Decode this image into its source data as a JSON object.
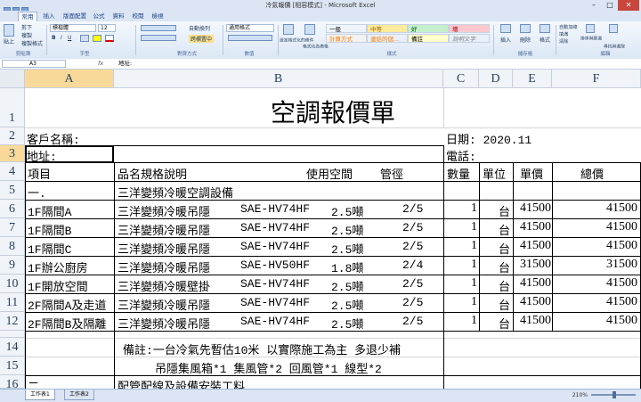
{
  "window": {
    "title": "冷氣報價 [相容模式] - Microsoft Excel",
    "buttons": [
      "–",
      "□",
      "✕"
    ]
  },
  "tabs": [
    {
      "label": "常用",
      "active": true
    },
    {
      "label": "插入"
    },
    {
      "label": "版面配置"
    },
    {
      "label": "公式"
    },
    {
      "label": "資料"
    },
    {
      "label": "校閱"
    },
    {
      "label": "檢視"
    }
  ],
  "ribbon": {
    "paste_label": "貼上",
    "cut_label": "剪下",
    "copy_label": "複製",
    "format_painter_label": "複製格式",
    "font_name": "標楷體",
    "font_size": "12",
    "wrap_text_label": "自動換列",
    "merge_center_label": "跨欄置中",
    "number_format": "通用格式",
    "cond_format_label": "設定格式化的條件",
    "format_table_label": "格式化為表格",
    "styles": [
      {
        "label": "一般",
        "color": "#ffffff",
        "text": "#000000"
      },
      {
        "label": "中等",
        "color": "#ffeb9c",
        "text": "#9c6500"
      },
      {
        "label": "好",
        "color": "#c6efce",
        "text": "#006100"
      },
      {
        "label": "壞",
        "color": "#ffc7ce",
        "text": "#9c0006"
      },
      {
        "label": "計算方式",
        "color": "#f2f2f2",
        "text": "#fa7d00"
      },
      {
        "label": "連結的儲...",
        "color": "#ffffff",
        "text": "#fa7d00"
      },
      {
        "label": "備註",
        "color": "#ffffcc",
        "text": "#000000"
      },
      {
        "label": "說明文字",
        "color": "#ffffff",
        "text": "#7f7f7f"
      }
    ],
    "insert_label": "插入",
    "delete_label": "刪除",
    "format_label": "格式",
    "autosum_label": "自動加總",
    "fill_label": "填滿",
    "clear_label": "清除",
    "sort_filter_label": "排序與篩選",
    "find_select_label": "尋找與選取",
    "groups": [
      "剪貼簿",
      "字型",
      "對齊方式",
      "數值",
      "樣式",
      "儲存格",
      "編輯"
    ]
  },
  "formula_bar": {
    "name_box": "A3",
    "fx": "fx",
    "content": "地址:"
  },
  "columns": [
    "A",
    "B",
    "C",
    "D",
    "E",
    "F"
  ],
  "rows": [
    "1",
    "2",
    "3",
    "4",
    "5",
    "6",
    "7",
    "8",
    "9",
    "10",
    "11",
    "12",
    "13",
    "14",
    "15",
    "16"
  ],
  "sheet": {
    "title": "空調報價單",
    "customer_label": "客戶名稱:",
    "date_label": "日期: 2020.11",
    "address_label": "地址:",
    "phone_label": "電話:",
    "headers": {
      "item": "項目",
      "spec": "品名規格說明",
      "space": "使用空間",
      "pipe": "管徑",
      "qty": "數量",
      "unit": "單位",
      "price": "單價",
      "total": "總價"
    },
    "section1_no": "一.",
    "section1_title": "三洋變頻冷暖空調設備",
    "items": [
      {
        "row": "6",
        "area": "1F隔間A",
        "name": "三洋變頻冷暖吊隱",
        "model": "SAE-HV74HF",
        "ton": "2.5噸",
        "pipe": "2/5",
        "qty": "1",
        "unit": "台",
        "price": "41500",
        "total": "41500"
      },
      {
        "row": "7",
        "area": "1F隔間B",
        "name": "三洋變頻冷暖吊隱",
        "model": "SAE-HV74HF",
        "ton": "2.5噸",
        "pipe": "2/5",
        "qty": "1",
        "unit": "台",
        "price": "41500",
        "total": "41500"
      },
      {
        "row": "8",
        "area": "1F隔間C",
        "name": "三洋變頻冷暖吊隱",
        "model": "SAE-HV74HF",
        "ton": "2.5噸",
        "pipe": "2/5",
        "qty": "1",
        "unit": "台",
        "price": "41500",
        "total": "41500"
      },
      {
        "row": "9",
        "area": "1F辦公廚房",
        "name": "三洋變頻冷暖吊隱",
        "model": "SAE-HV50HF",
        "ton": "1.8噸",
        "pipe": "2/4",
        "qty": "1",
        "unit": "台",
        "price": "31500",
        "total": "31500"
      },
      {
        "row": "10",
        "area": "1F開放空間",
        "name": "三洋變頻冷暖壁掛",
        "model": "SAE-HV74HF",
        "ton": "2.5噸",
        "pipe": "2/5",
        "qty": "1",
        "unit": "台",
        "price": "41500",
        "total": "41500"
      },
      {
        "row": "11",
        "area": "2F隔間A及走道",
        "name": "三洋變頻冷暖吊隱",
        "model": "SAE-HV74HF",
        "ton": "2.5噸",
        "pipe": "2/5",
        "qty": "1",
        "unit": "台",
        "price": "41500",
        "total": "41500"
      },
      {
        "row": "12",
        "area": "2F隔間B及隔離",
        "name": "三洋變頻冷暖吊隱",
        "model": "SAE-HV74HF",
        "ton": "2.5噸",
        "pipe": "2/5",
        "qty": "1",
        "unit": "台",
        "price": "41500",
        "total": "41500"
      }
    ],
    "note_line1": "備註:一台冷氣先暫估10米   以實際施工為主 多退少補",
    "note_line2": "吊隱集風箱*1 集風管*2 回風管*1 線型*2",
    "section2_no": "二.",
    "section2_title": "配管配線及設備安裝工料"
  },
  "statusbar": {
    "sheet_tabs": [
      "工作表1",
      "工作表2"
    ],
    "zoom": "210%"
  }
}
